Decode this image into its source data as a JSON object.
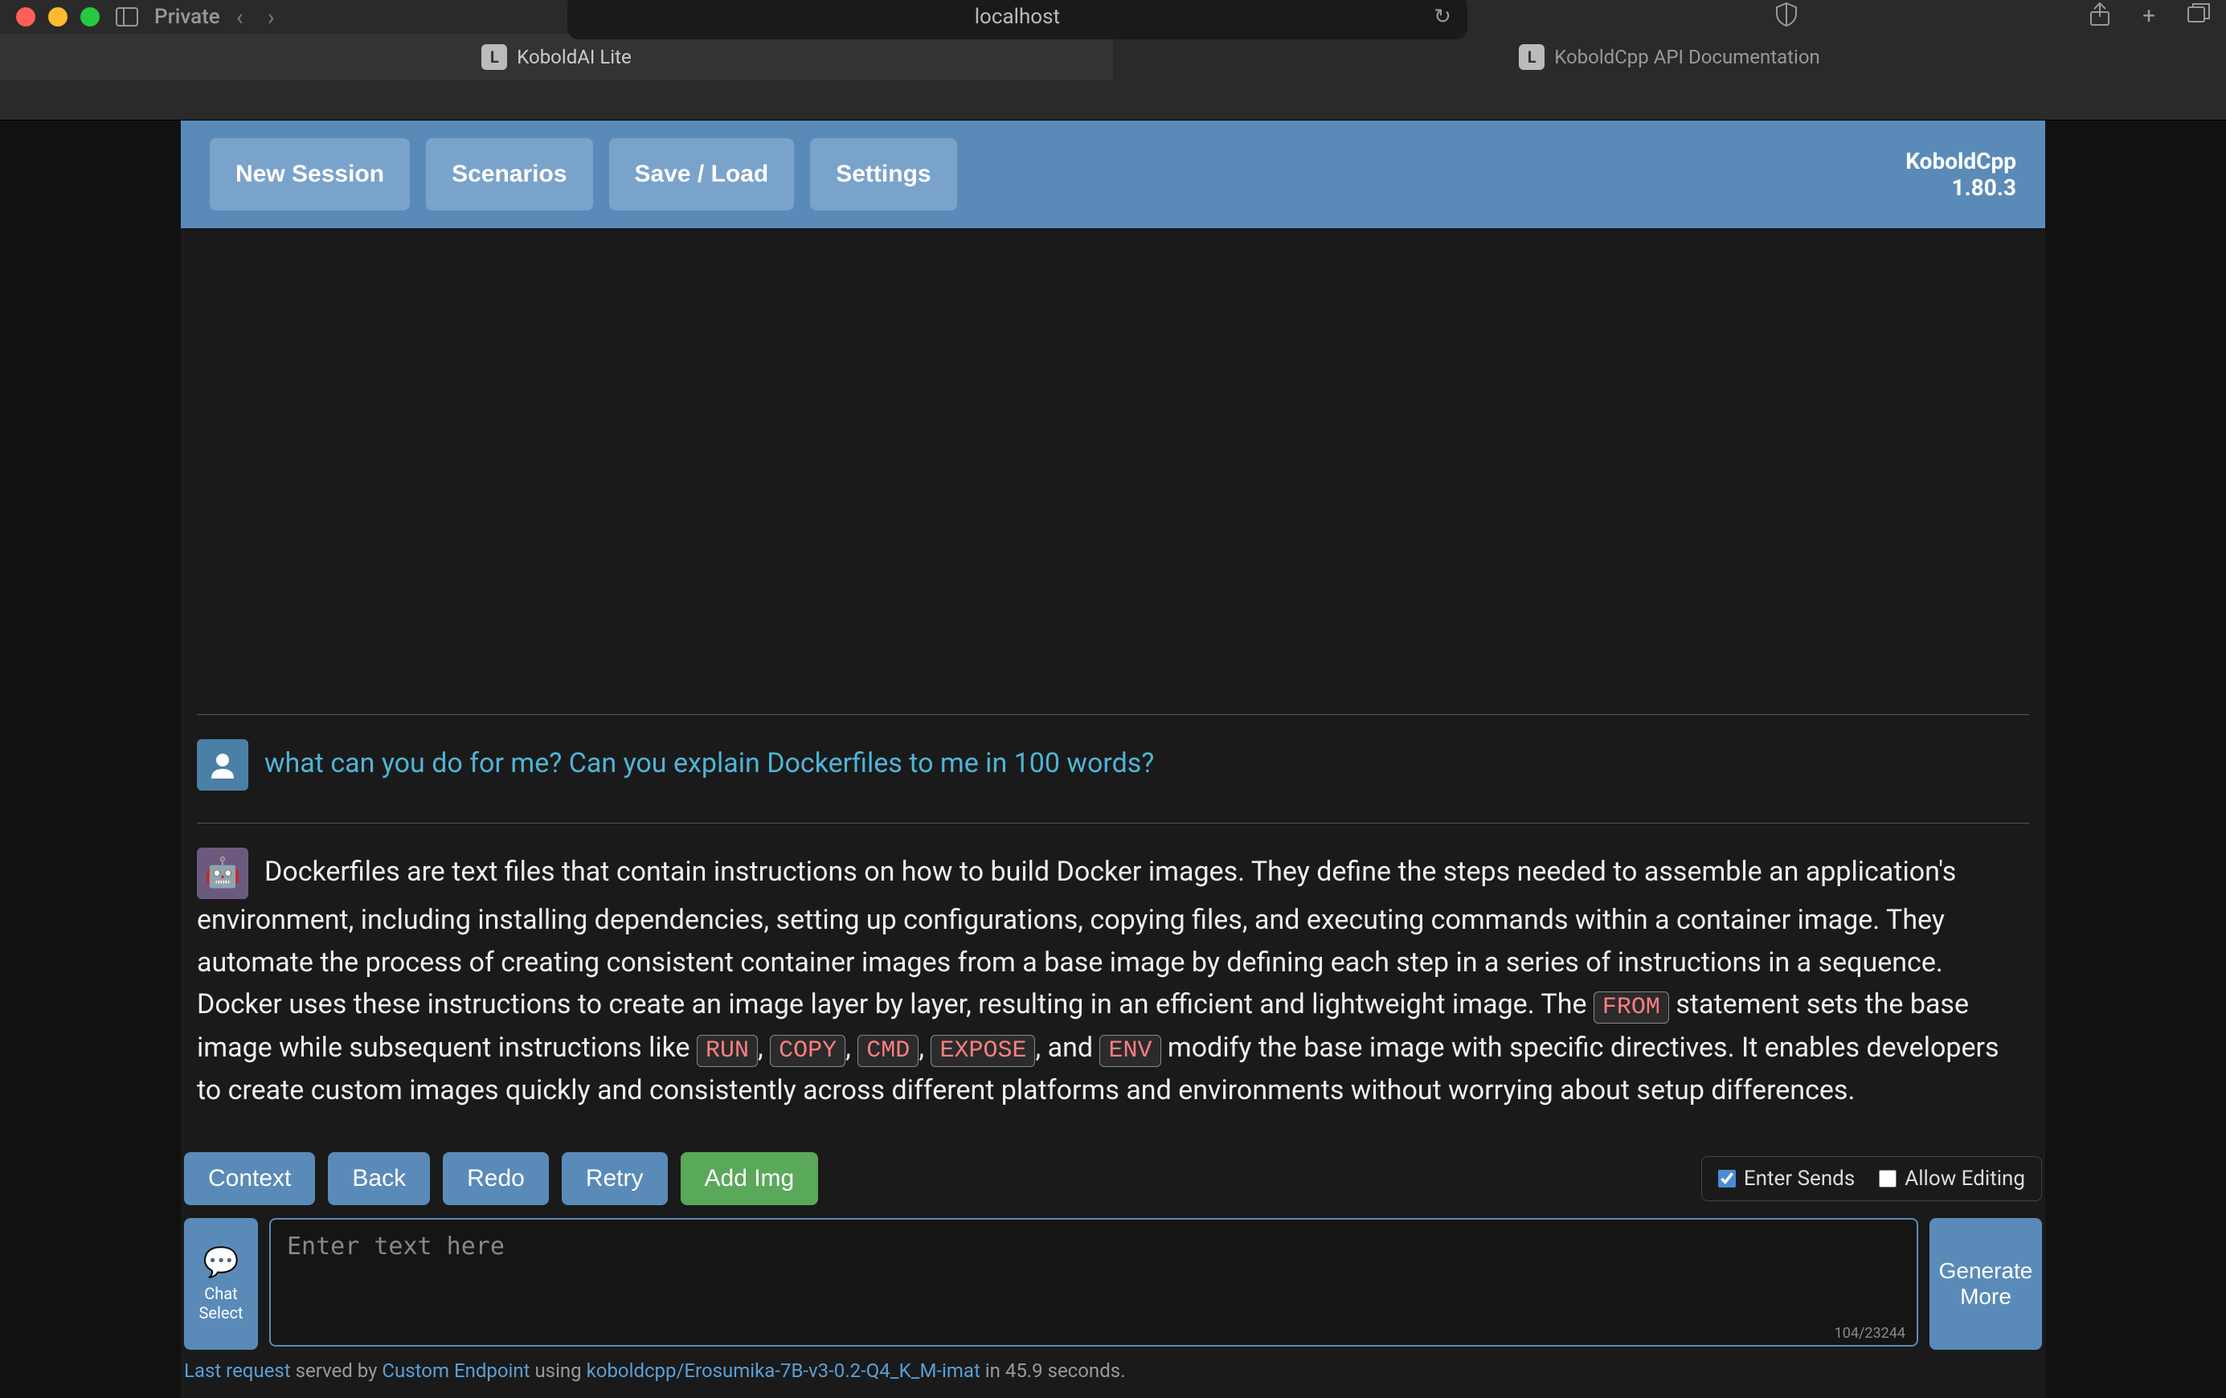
{
  "browser": {
    "private_label": "Private",
    "url": "localhost",
    "tabs": [
      {
        "favicon": "L",
        "title": "KoboldAI Lite",
        "active": true
      },
      {
        "favicon": "L",
        "title": "KoboldCpp API Documentation",
        "active": false
      }
    ]
  },
  "header": {
    "buttons": {
      "new_session": "New Session",
      "scenarios": "Scenarios",
      "save_load": "Save / Load",
      "settings": "Settings"
    },
    "app_name": "KoboldCpp",
    "version": "1.80.3"
  },
  "chat": {
    "user_message": "what can you do for me? Can you explain Dockerfiles to me in 100 words?",
    "bot_message_parts": {
      "p1": "Dockerfiles are text files that contain instructions on how to build Docker images. They define the steps needed to assemble an application's environment, including installing dependencies, setting up configurations, copying files, and executing commands within a container image. They automate the process of creating consistent container images from a base image by defining each step in a series of instructions in a sequence. Docker uses these instructions to create an image layer by layer, resulting in an efficient and lightweight image. The ",
      "c1": "FROM",
      "p2": " statement sets the base image while subsequent instructions like ",
      "c2": "RUN",
      "p3": ", ",
      "c3": "COPY",
      "p4": ", ",
      "c4": "CMD",
      "p5": ", ",
      "c5": "EXPOSE",
      "p6": ", and ",
      "c6": "ENV",
      "p7": " modify the base image with specific directives. It enables developers to create custom images quickly and consistently across different platforms and environments without worrying about setup differences."
    }
  },
  "actions": {
    "context": "Context",
    "back": "Back",
    "redo": "Redo",
    "retry": "Retry",
    "add_img": "Add Img"
  },
  "options": {
    "enter_sends_label": "Enter Sends",
    "enter_sends_checked": true,
    "allow_editing_label": "Allow Editing",
    "allow_editing_checked": false
  },
  "input": {
    "chat_select_line1": "Chat",
    "chat_select_line2": "Select",
    "placeholder": "Enter text here",
    "token_count": "104/23244",
    "generate_line1": "Generate",
    "generate_line2": "More"
  },
  "status": {
    "s1": "Last request",
    "s2": " served by ",
    "s3": "Custom Endpoint",
    "s4": " using ",
    "s5": "koboldcpp/Erosumika-7B-v3-0.2-Q4_K_M-imat",
    "s6": " in 45.9 seconds."
  }
}
